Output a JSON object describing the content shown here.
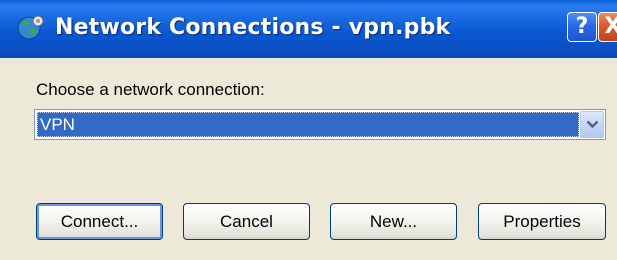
{
  "window": {
    "title": "Network Connections - vpn.pbk",
    "help_label": "?",
    "close_label": "X"
  },
  "dialog": {
    "prompt_label": "Choose a network connection:",
    "connection_select": {
      "selected_value": "VPN"
    },
    "buttons": {
      "connect_label": "Connect...",
      "cancel_label": "Cancel",
      "new_label": "New...",
      "properties_label": "Properties"
    }
  },
  "colors": {
    "titlebar": "#0a58d2",
    "selection": "#316ac5",
    "close_button": "#dc5a30",
    "window_bg": "#ece9d8"
  },
  "icons": {
    "title_icon": "network-globe-icon",
    "dropdown_icon": "chevron-down-icon"
  }
}
